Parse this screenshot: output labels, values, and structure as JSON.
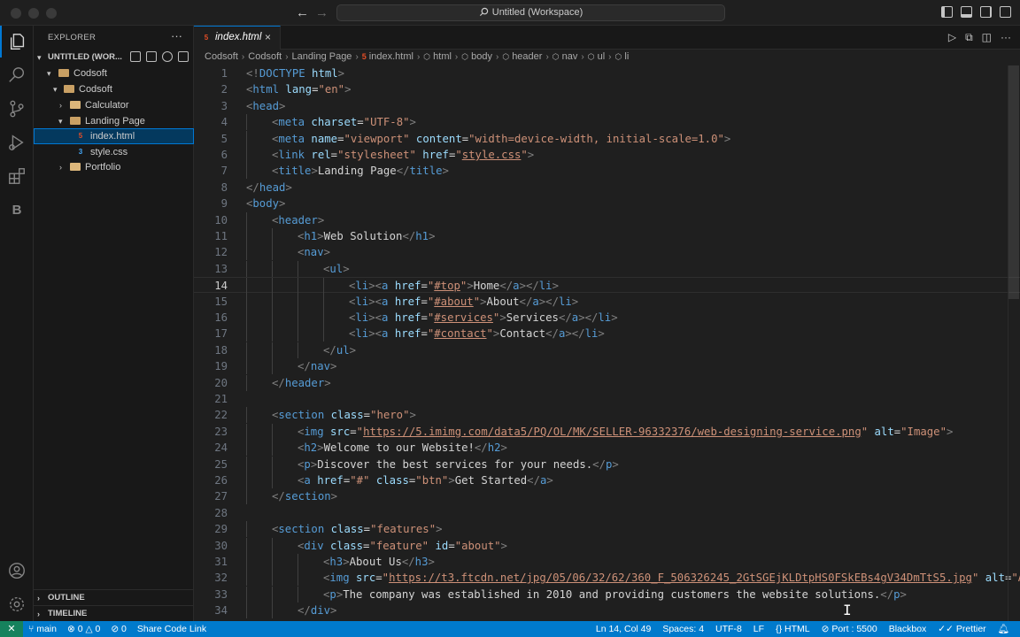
{
  "titlebar": {
    "search_text": "Untitled (Workspace)",
    "back_icon": "arrow-left-icon",
    "forward_icon": "arrow-right-icon"
  },
  "activity_bar": {
    "items": [
      "explorer-icon",
      "search-icon",
      "source-control-icon",
      "run-debug-icon",
      "extensions-icon",
      "blackbox-icon"
    ],
    "blackbox_letter": "B",
    "bottom": [
      "account-icon",
      "manage-gear-icon"
    ]
  },
  "explorer": {
    "title": "EXPLORER",
    "more": "···",
    "workspace": "UNTITLED (WOR...",
    "tree": [
      {
        "label": "Codsoft",
        "kind": "root-folder"
      },
      {
        "label": "Codsoft",
        "kind": "folder-open"
      },
      {
        "label": "Calculator",
        "kind": "folder"
      },
      {
        "label": "Landing Page",
        "kind": "folder-open"
      },
      {
        "label": "index.html",
        "kind": "html",
        "icon": "5"
      },
      {
        "label": "style.css",
        "kind": "css",
        "icon": "3"
      },
      {
        "label": "Portfolio",
        "kind": "folder"
      }
    ],
    "outline": "OUTLINE",
    "timeline": "TIMELINE"
  },
  "tab": {
    "icon": "5",
    "label": "index.html",
    "close": "×"
  },
  "breadcrumb": {
    "items": [
      "Codsoft",
      "Codsoft",
      "Landing Page",
      "index.html",
      "html",
      "body",
      "header",
      "nav",
      "ul",
      "li"
    ],
    "sep": "›",
    "html_icon": "5",
    "tag_icon": "⬡"
  },
  "editor": {
    "current_line": 14,
    "lines": [
      {
        "n": "1",
        "indent": 0,
        "parts": [
          [
            "t",
            "<!"
          ],
          [
            "tg",
            "DOCTYPE"
          ],
          [
            "at",
            " html"
          ],
          [
            "t",
            ">"
          ]
        ]
      },
      {
        "n": "2",
        "indent": 0,
        "parts": [
          [
            "t",
            "<"
          ],
          [
            "tg",
            "html"
          ],
          [
            "at",
            " lang"
          ],
          [
            "tx",
            "="
          ],
          [
            "st",
            "\"en\""
          ],
          [
            "t",
            ">"
          ]
        ]
      },
      {
        "n": "3",
        "indent": 0,
        "parts": [
          [
            "t",
            "<"
          ],
          [
            "tg",
            "head"
          ],
          [
            "t",
            ">"
          ]
        ]
      },
      {
        "n": "4",
        "indent": 1,
        "parts": [
          [
            "t",
            "<"
          ],
          [
            "tg",
            "meta"
          ],
          [
            "at",
            " charset"
          ],
          [
            "tx",
            "="
          ],
          [
            "st",
            "\"UTF-8\""
          ],
          [
            "t",
            ">"
          ]
        ]
      },
      {
        "n": "5",
        "indent": 1,
        "parts": [
          [
            "t",
            "<"
          ],
          [
            "tg",
            "meta"
          ],
          [
            "at",
            " name"
          ],
          [
            "tx",
            "="
          ],
          [
            "st",
            "\"viewport\""
          ],
          [
            "at",
            " content"
          ],
          [
            "tx",
            "="
          ],
          [
            "st",
            "\"width=device-width, initial-scale=1.0\""
          ],
          [
            "t",
            ">"
          ]
        ]
      },
      {
        "n": "6",
        "indent": 1,
        "parts": [
          [
            "t",
            "<"
          ],
          [
            "tg",
            "link"
          ],
          [
            "at",
            " rel"
          ],
          [
            "tx",
            "="
          ],
          [
            "st",
            "\"stylesheet\""
          ],
          [
            "at",
            " href"
          ],
          [
            "tx",
            "="
          ],
          [
            "st",
            "\""
          ],
          [
            "lk",
            "style.css"
          ],
          [
            "st",
            "\""
          ],
          [
            "t",
            ">"
          ]
        ]
      },
      {
        "n": "7",
        "indent": 1,
        "parts": [
          [
            "t",
            "<"
          ],
          [
            "tg",
            "title"
          ],
          [
            "t",
            ">"
          ],
          [
            "tx",
            "Landing Page"
          ],
          [
            "t",
            "</"
          ],
          [
            "tg",
            "title"
          ],
          [
            "t",
            ">"
          ]
        ]
      },
      {
        "n": "8",
        "indent": 0,
        "parts": [
          [
            "t",
            "</"
          ],
          [
            "tg",
            "head"
          ],
          [
            "t",
            ">"
          ]
        ]
      },
      {
        "n": "9",
        "indent": 0,
        "parts": [
          [
            "t",
            "<"
          ],
          [
            "tg",
            "body"
          ],
          [
            "t",
            ">"
          ]
        ]
      },
      {
        "n": "10",
        "indent": 1,
        "parts": [
          [
            "t",
            "<"
          ],
          [
            "tg",
            "header"
          ],
          [
            "t",
            ">"
          ]
        ]
      },
      {
        "n": "11",
        "indent": 2,
        "parts": [
          [
            "t",
            "<"
          ],
          [
            "tg",
            "h1"
          ],
          [
            "t",
            ">"
          ],
          [
            "tx",
            "Web Solution"
          ],
          [
            "t",
            "</"
          ],
          [
            "tg",
            "h1"
          ],
          [
            "t",
            ">"
          ]
        ]
      },
      {
        "n": "12",
        "indent": 2,
        "parts": [
          [
            "t",
            "<"
          ],
          [
            "tg",
            "nav"
          ],
          [
            "t",
            ">"
          ]
        ]
      },
      {
        "n": "13",
        "indent": 3,
        "parts": [
          [
            "t",
            "<"
          ],
          [
            "tg",
            "ul"
          ],
          [
            "t",
            ">"
          ]
        ]
      },
      {
        "n": "14",
        "indent": 4,
        "parts": [
          [
            "t",
            "<"
          ],
          [
            "tg",
            "li"
          ],
          [
            "t",
            "><"
          ],
          [
            "tg",
            "a"
          ],
          [
            "at",
            " href"
          ],
          [
            "tx",
            "="
          ],
          [
            "st",
            "\""
          ],
          [
            "lk",
            "#top"
          ],
          [
            "st",
            "\""
          ],
          [
            "t",
            ">"
          ],
          [
            "tx",
            "Home"
          ],
          [
            "t",
            "</"
          ],
          [
            "tg",
            "a"
          ],
          [
            "t",
            "></"
          ],
          [
            "tg",
            "li"
          ],
          [
            "t",
            ">"
          ]
        ]
      },
      {
        "n": "15",
        "indent": 4,
        "parts": [
          [
            "t",
            "<"
          ],
          [
            "tg",
            "li"
          ],
          [
            "t",
            "><"
          ],
          [
            "tg",
            "a"
          ],
          [
            "at",
            " href"
          ],
          [
            "tx",
            "="
          ],
          [
            "st",
            "\""
          ],
          [
            "lk",
            "#about"
          ],
          [
            "st",
            "\""
          ],
          [
            "t",
            ">"
          ],
          [
            "tx",
            "About"
          ],
          [
            "t",
            "</"
          ],
          [
            "tg",
            "a"
          ],
          [
            "t",
            "></"
          ],
          [
            "tg",
            "li"
          ],
          [
            "t",
            ">"
          ]
        ]
      },
      {
        "n": "16",
        "indent": 4,
        "parts": [
          [
            "t",
            "<"
          ],
          [
            "tg",
            "li"
          ],
          [
            "t",
            "><"
          ],
          [
            "tg",
            "a"
          ],
          [
            "at",
            " href"
          ],
          [
            "tx",
            "="
          ],
          [
            "st",
            "\""
          ],
          [
            "lk",
            "#services"
          ],
          [
            "st",
            "\""
          ],
          [
            "t",
            ">"
          ],
          [
            "tx",
            "Services"
          ],
          [
            "t",
            "</"
          ],
          [
            "tg",
            "a"
          ],
          [
            "t",
            "></"
          ],
          [
            "tg",
            "li"
          ],
          [
            "t",
            ">"
          ]
        ]
      },
      {
        "n": "17",
        "indent": 4,
        "parts": [
          [
            "t",
            "<"
          ],
          [
            "tg",
            "li"
          ],
          [
            "t",
            "><"
          ],
          [
            "tg",
            "a"
          ],
          [
            "at",
            " href"
          ],
          [
            "tx",
            "="
          ],
          [
            "st",
            "\""
          ],
          [
            "lk",
            "#contact"
          ],
          [
            "st",
            "\""
          ],
          [
            "t",
            ">"
          ],
          [
            "tx",
            "Contact"
          ],
          [
            "t",
            "</"
          ],
          [
            "tg",
            "a"
          ],
          [
            "t",
            "></"
          ],
          [
            "tg",
            "li"
          ],
          [
            "t",
            ">"
          ]
        ]
      },
      {
        "n": "18",
        "indent": 3,
        "parts": [
          [
            "t",
            "</"
          ],
          [
            "tg",
            "ul"
          ],
          [
            "t",
            ">"
          ]
        ]
      },
      {
        "n": "19",
        "indent": 2,
        "parts": [
          [
            "t",
            "</"
          ],
          [
            "tg",
            "nav"
          ],
          [
            "t",
            ">"
          ]
        ]
      },
      {
        "n": "20",
        "indent": 1,
        "parts": [
          [
            "t",
            "</"
          ],
          [
            "tg",
            "header"
          ],
          [
            "t",
            ">"
          ]
        ]
      },
      {
        "n": "21",
        "indent": 0,
        "parts": []
      },
      {
        "n": "22",
        "indent": 1,
        "parts": [
          [
            "t",
            "<"
          ],
          [
            "tg",
            "section"
          ],
          [
            "at",
            " class"
          ],
          [
            "tx",
            "="
          ],
          [
            "st",
            "\"hero\""
          ],
          [
            "t",
            ">"
          ]
        ]
      },
      {
        "n": "23",
        "indent": 2,
        "parts": [
          [
            "t",
            "<"
          ],
          [
            "tg",
            "img"
          ],
          [
            "at",
            " src"
          ],
          [
            "tx",
            "="
          ],
          [
            "st",
            "\""
          ],
          [
            "lk",
            "https://5.imimg.com/data5/PQ/OL/MK/SELLER-96332376/web-designing-service.png"
          ],
          [
            "st",
            "\""
          ],
          [
            "at",
            " alt"
          ],
          [
            "tx",
            "="
          ],
          [
            "st",
            "\"Image\""
          ],
          [
            "t",
            ">"
          ]
        ]
      },
      {
        "n": "24",
        "indent": 2,
        "parts": [
          [
            "t",
            "<"
          ],
          [
            "tg",
            "h2"
          ],
          [
            "t",
            ">"
          ],
          [
            "tx",
            "Welcome to our Website!"
          ],
          [
            "t",
            "</"
          ],
          [
            "tg",
            "h2"
          ],
          [
            "t",
            ">"
          ]
        ]
      },
      {
        "n": "25",
        "indent": 2,
        "parts": [
          [
            "t",
            "<"
          ],
          [
            "tg",
            "p"
          ],
          [
            "t",
            ">"
          ],
          [
            "tx",
            "Discover the best services for your needs."
          ],
          [
            "t",
            "</"
          ],
          [
            "tg",
            "p"
          ],
          [
            "t",
            ">"
          ]
        ]
      },
      {
        "n": "26",
        "indent": 2,
        "parts": [
          [
            "t",
            "<"
          ],
          [
            "tg",
            "a"
          ],
          [
            "at",
            " href"
          ],
          [
            "tx",
            "="
          ],
          [
            "st",
            "\"#\""
          ],
          [
            "at",
            " class"
          ],
          [
            "tx",
            "="
          ],
          [
            "st",
            "\"btn\""
          ],
          [
            "t",
            ">"
          ],
          [
            "tx",
            "Get Started"
          ],
          [
            "t",
            "</"
          ],
          [
            "tg",
            "a"
          ],
          [
            "t",
            ">"
          ]
        ]
      },
      {
        "n": "27",
        "indent": 1,
        "parts": [
          [
            "t",
            "</"
          ],
          [
            "tg",
            "section"
          ],
          [
            "t",
            ">"
          ]
        ]
      },
      {
        "n": "28",
        "indent": 0,
        "parts": []
      },
      {
        "n": "29",
        "indent": 1,
        "parts": [
          [
            "t",
            "<"
          ],
          [
            "tg",
            "section"
          ],
          [
            "at",
            " class"
          ],
          [
            "tx",
            "="
          ],
          [
            "st",
            "\"features\""
          ],
          [
            "t",
            ">"
          ]
        ]
      },
      {
        "n": "30",
        "indent": 2,
        "parts": [
          [
            "t",
            "<"
          ],
          [
            "tg",
            "div"
          ],
          [
            "at",
            " class"
          ],
          [
            "tx",
            "="
          ],
          [
            "st",
            "\"feature\""
          ],
          [
            "at",
            " id"
          ],
          [
            "tx",
            "="
          ],
          [
            "st",
            "\"about\""
          ],
          [
            "t",
            ">"
          ]
        ]
      },
      {
        "n": "31",
        "indent": 3,
        "parts": [
          [
            "t",
            "<"
          ],
          [
            "tg",
            "h3"
          ],
          [
            "t",
            ">"
          ],
          [
            "tx",
            "About Us"
          ],
          [
            "t",
            "</"
          ],
          [
            "tg",
            "h3"
          ],
          [
            "t",
            ">"
          ]
        ]
      },
      {
        "n": "32",
        "indent": 3,
        "parts": [
          [
            "t",
            "<"
          ],
          [
            "tg",
            "img"
          ],
          [
            "at",
            " src"
          ],
          [
            "tx",
            "="
          ],
          [
            "st",
            "\""
          ],
          [
            "lk",
            "https://t3.ftcdn.net/jpg/05/06/32/62/360_F_506326245_2GtSGEjKLDtpHS0FSkEBs4gV34DmTtS5.jpg"
          ],
          [
            "st",
            "\""
          ],
          [
            "at",
            " alt"
          ],
          [
            "tx",
            "="
          ],
          [
            "st",
            "\"Abo"
          ]
        ]
      },
      {
        "n": "33",
        "indent": 3,
        "parts": [
          [
            "t",
            "<"
          ],
          [
            "tg",
            "p"
          ],
          [
            "t",
            ">"
          ],
          [
            "tx",
            "The company was established in 2010 and providing customers the website solutions."
          ],
          [
            "t",
            "</"
          ],
          [
            "tg",
            "p"
          ],
          [
            "t",
            ">"
          ]
        ]
      },
      {
        "n": "34",
        "indent": 2,
        "parts": [
          [
            "t",
            "</"
          ],
          [
            "tg",
            "div"
          ],
          [
            "t",
            ">"
          ]
        ]
      }
    ]
  },
  "statusbar": {
    "remote_icon": "remote-icon",
    "branch": "main",
    "errors": "0",
    "warnings": "0",
    "ports": "0",
    "share": "Share Code Link",
    "position": "Ln 14, Col 49",
    "spaces": "Spaces: 4",
    "encoding": "UTF-8",
    "eol": "LF",
    "language": "HTML",
    "port": "Port : 5500",
    "blackbox": "Blackbox",
    "prettier": "Prettier"
  }
}
